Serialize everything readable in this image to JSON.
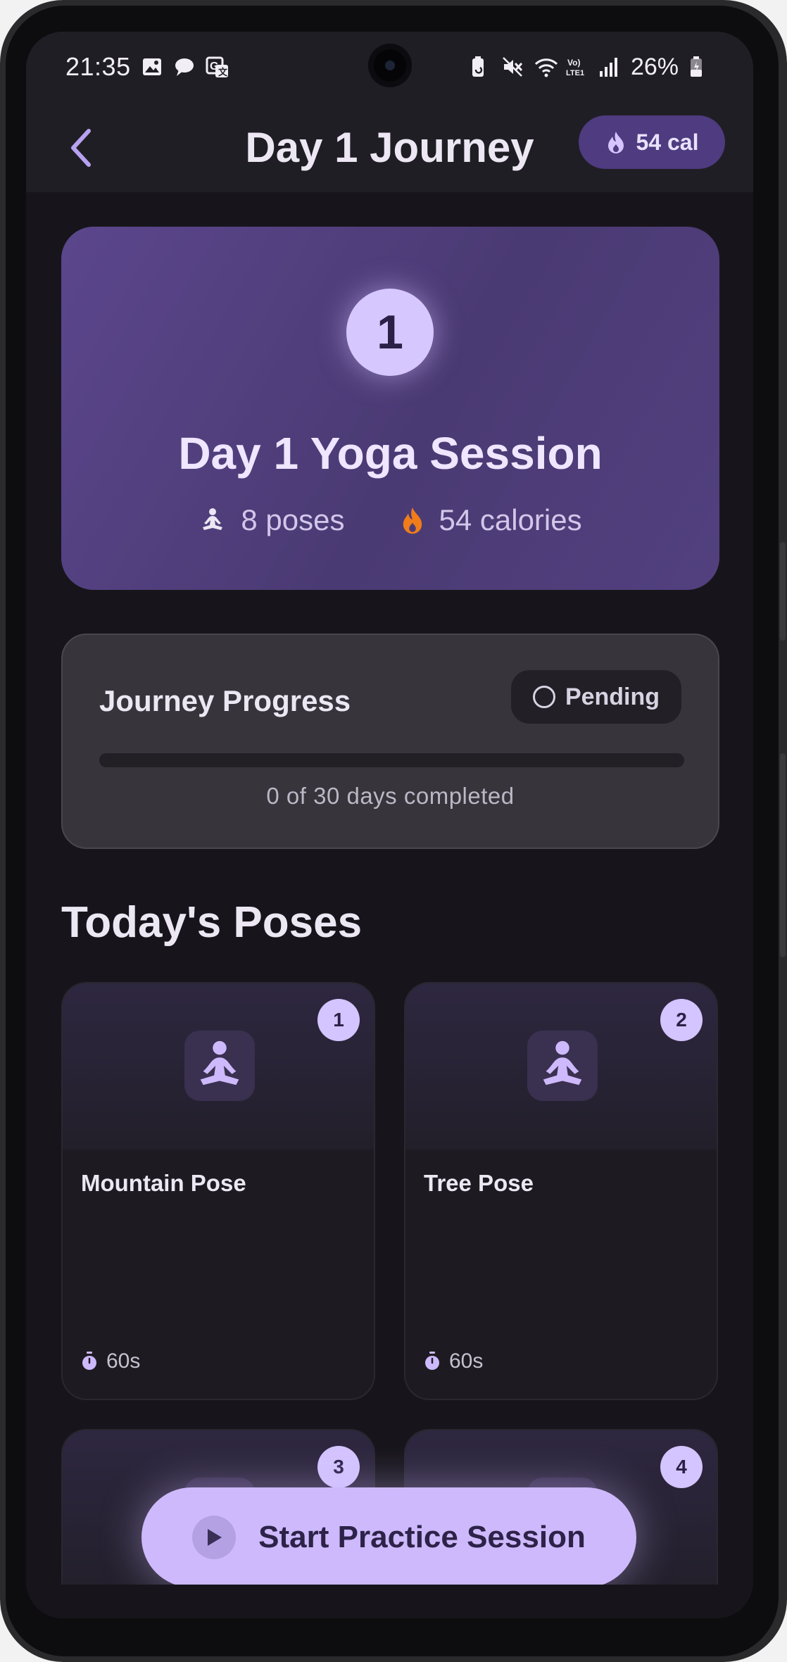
{
  "status_bar": {
    "time": "21:35",
    "battery": "26%"
  },
  "app_bar": {
    "title": "Day 1 Journey",
    "calories_chip": "54 cal"
  },
  "hero": {
    "day_number": "1",
    "title": "Day 1 Yoga Session",
    "poses": "8 poses",
    "calories": "54 calories"
  },
  "progress": {
    "title": "Journey Progress",
    "status": "Pending",
    "completed_fraction": 0,
    "summary": "0 of 30 days completed"
  },
  "poses_section": {
    "title": "Today's Poses",
    "items": [
      {
        "number": "1",
        "name": "Mountain Pose",
        "duration": "60s"
      },
      {
        "number": "2",
        "name": "Tree Pose",
        "duration": "60s"
      },
      {
        "number": "3",
        "name": "",
        "duration": ""
      },
      {
        "number": "4",
        "name": "",
        "duration": ""
      }
    ]
  },
  "cta": {
    "label": "Start Practice Session"
  },
  "colors": {
    "accent": "#cdb9fb",
    "background": "#17151b",
    "flame": "#f07d1a"
  }
}
